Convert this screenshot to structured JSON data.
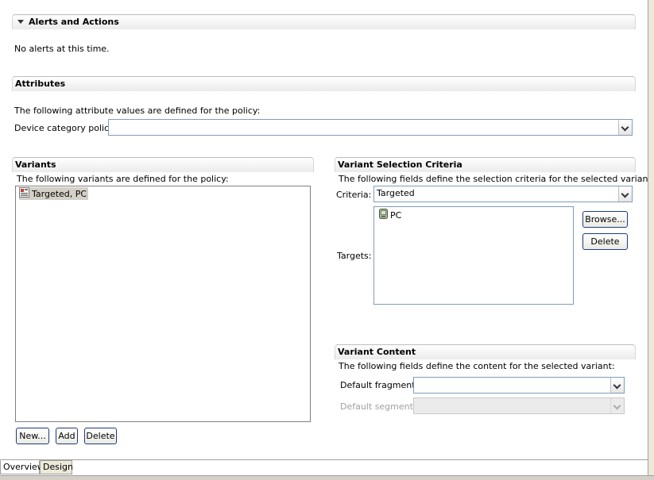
{
  "alerts": {
    "title": "Alerts and Actions",
    "message": "No alerts at this time."
  },
  "attributes": {
    "title": "Attributes",
    "description": "The following attribute values are defined for the policy:",
    "device_category_label": "Device category policy:",
    "device_category_value": ""
  },
  "variants": {
    "title": "Variants",
    "description": "The following variants are defined for the policy:",
    "items": [
      {
        "label": "Targeted, PC",
        "icon": "variant-icon",
        "selected": true
      }
    ],
    "buttons": {
      "new": "New...",
      "add": "Add",
      "delete": "Delete"
    }
  },
  "selection_criteria": {
    "title": "Variant Selection Criteria",
    "description": "The following fields define the selection criteria for the selected variant:",
    "criteria_label": "Criteria:",
    "criteria_value": "Targeted",
    "targets_label": "Targets:",
    "targets": [
      {
        "label": "PC",
        "icon": "device-icon"
      }
    ],
    "buttons": {
      "browse": "Browse...",
      "delete": "Delete"
    }
  },
  "variant_content": {
    "title": "Variant Content",
    "description": "The following fields define the content for the selected variant:",
    "default_fragment_label": "Default fragment:",
    "default_fragment_value": "",
    "default_segment_label": "Default segment:",
    "default_segment_value": ""
  },
  "tabs": [
    {
      "label": "Overview",
      "active": true
    },
    {
      "label": "Design",
      "active": false
    }
  ]
}
